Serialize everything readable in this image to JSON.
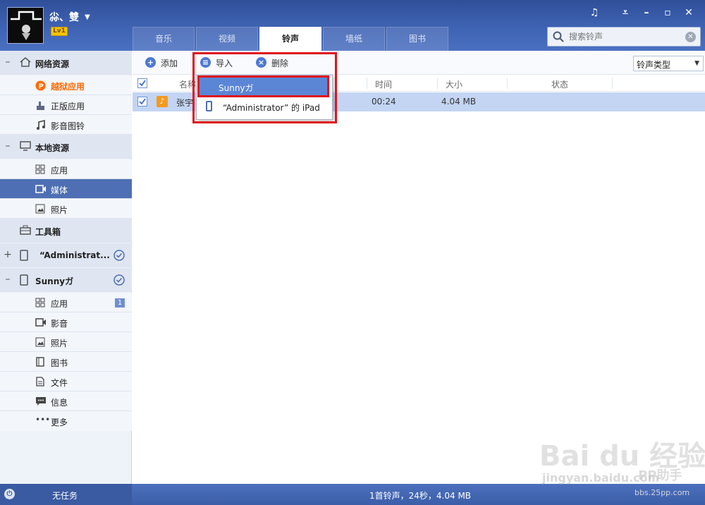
{
  "user": {
    "name": "尛、雙",
    "level": "Lv1"
  },
  "tabs": [
    {
      "label": "音乐"
    },
    {
      "label": "视频"
    },
    {
      "label": "铃声"
    },
    {
      "label": "墙纸"
    },
    {
      "label": "图书"
    }
  ],
  "active_tab": "铃声",
  "search": {
    "placeholder": "搜索铃声"
  },
  "sidebar": {
    "online": {
      "label": "网络资源",
      "items": [
        {
          "label": "越狱应用",
          "icon": "p-badge-icon"
        },
        {
          "label": "正版应用",
          "icon": "hand-icon"
        },
        {
          "label": "影音图铃",
          "icon": "music-note-icon"
        }
      ]
    },
    "local": {
      "label": "本地资源",
      "items": [
        {
          "label": "应用",
          "icon": "grid-icon"
        },
        {
          "label": "媒体",
          "icon": "video-icon"
        },
        {
          "label": "照片",
          "icon": "image-icon"
        }
      ]
    },
    "toolbox": {
      "label": "工具箱"
    },
    "device1": {
      "label": "“Administrat..."
    },
    "device2": {
      "label": "Sunnyガ",
      "items": [
        {
          "label": "应用",
          "badge": "1"
        },
        {
          "label": "影音"
        },
        {
          "label": "照片"
        },
        {
          "label": "图书"
        },
        {
          "label": "文件"
        },
        {
          "label": "信息"
        },
        {
          "label": "更多"
        }
      ]
    }
  },
  "toolbar": {
    "add": "添加",
    "import": "导入",
    "delete": "删除",
    "ringtone_type": "铃声类型"
  },
  "table": {
    "headers": {
      "name": "名称",
      "time": "时间",
      "size": "大小",
      "status": "状态"
    },
    "rows": [
      {
        "name": "张宇",
        "time": "00:24",
        "size": "4.04 MB",
        "status": ""
      }
    ]
  },
  "import_menu": [
    {
      "label": "Sunnyガ"
    },
    {
      "label": "“Administrator” 的 iPad"
    }
  ],
  "status": {
    "task": "无任务",
    "summary": "1首铃声，24秒，4.04 MB"
  },
  "watermark": {
    "text": "Bai du 经验",
    "pp": "PP助手",
    "url1": "jingyan.baidu.com",
    "url2": "bbs.25pp.com"
  },
  "colors": {
    "title_bar": "#3f63b3",
    "selected": "#4e6fb3",
    "row_highlight": "#c3d5f3",
    "accent": "#ff6a00",
    "annotation": "#e0141a"
  }
}
